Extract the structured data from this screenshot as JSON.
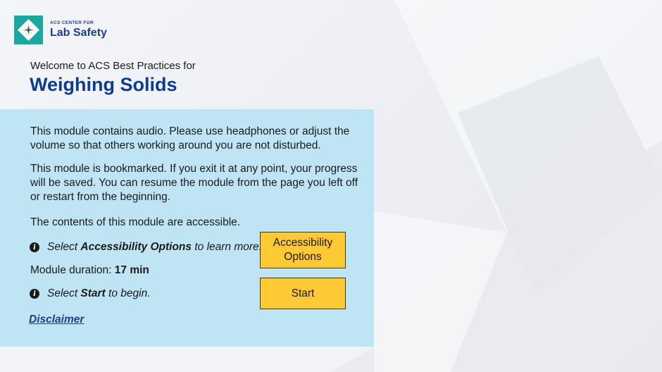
{
  "logo": {
    "line1": "ACS CENTER FOR",
    "line2": "Lab Safety",
    "colors": {
      "mark": "#1aa9a0",
      "text": "#1d3e8a"
    }
  },
  "header": {
    "welcome": "Welcome to ACS Best Practices for",
    "title": "Weighing Solids"
  },
  "panel": {
    "background": "#bfe5f4",
    "audio_note": "This module contains audio. Please use headphones or adjust the volume so that others working around you are not disturbed.",
    "bookmark_note": "This module is bookmarked. If you exit it at any point, your progress will be saved. You can resume the module from the page you left off or restart from the beginning.",
    "accessible_note": "The contents of this module are accessible.",
    "accessibility_hint": {
      "prefix": "Select ",
      "bold": "Accessibility Options",
      "suffix": " to learn more.",
      "icon": "info-icon"
    },
    "duration": {
      "label": "Module duration: ",
      "value": "17 min"
    },
    "start_hint": {
      "prefix": "Select ",
      "bold": "Start",
      "suffix": " to begin.",
      "icon": "info-icon"
    },
    "disclaimer": "Disclaimer"
  },
  "buttons": {
    "accessibility_line1": "Accessibility",
    "accessibility_line2": "Options",
    "start": "Start",
    "color": "#fdc934"
  }
}
